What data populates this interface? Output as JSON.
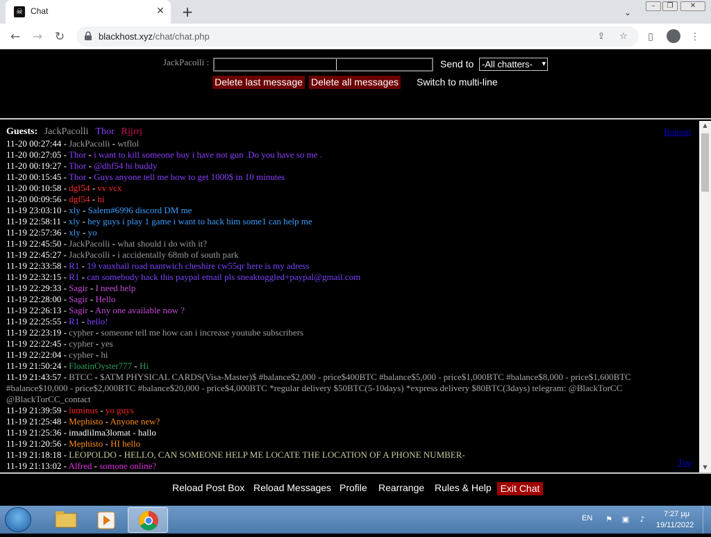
{
  "browser": {
    "tab_title": "Chat",
    "tab_favicon": "☠",
    "url_host": "blackhost.xyz",
    "url_path": "/chat/chat.php"
  },
  "postbox": {
    "nickname": "JackPacolli",
    "nick_suffix": " :",
    "message_value": "",
    "sendto_label": "Send to",
    "sendto_selected": "-All chatters-",
    "delete_last": "Delete last message",
    "delete_all": "Delete all messages",
    "switch_multiline": "Switch to multi-line"
  },
  "messages": {
    "guests_label": "Guests:",
    "guests": [
      {
        "name": "JackPacolli",
        "color": "#9a9a9a"
      },
      {
        "name": "Thor",
        "color": "#8b3fff"
      },
      {
        "name": "Rjjrrj",
        "color": "#cc1155"
      }
    ],
    "bottom_link": "Bottom",
    "top_link": "Top",
    "lines": [
      {
        "ts": "11-20 00:27:44",
        "user": "JackPacolli",
        "text": "wtflol",
        "color": "#9a9a9a"
      },
      {
        "ts": "11-20 00:27:05",
        "user": "Thor",
        "text": "i want to kill someone buy i have not gun .Do you have so me .",
        "color": "#8b3fff"
      },
      {
        "ts": "11-20 00:19:27",
        "user": "Thor",
        "text": "@dhf54 hi buddy",
        "color": "#8b3fff"
      },
      {
        "ts": "11-20 00:15:45",
        "user": "Thor",
        "text": "Guys anyone tell me how to get 1000$ in 10 minutes",
        "color": "#8b3fff"
      },
      {
        "ts": "11-20 00:10:58",
        "user": "dgf54",
        "text": "vv vcx",
        "color": "#ff2a2a"
      },
      {
        "ts": "11-20 00:09:56",
        "user": "dgf54",
        "text": "hi",
        "color": "#ff2a2a"
      },
      {
        "ts": "11-19 23:03:10",
        "user": "xly",
        "text": "Salem#6996 discord DM me",
        "color": "#3aa0ff"
      },
      {
        "ts": "11-19 22:58:11",
        "user": "xly",
        "text": "hey guys i play 1 game i want to hack him some1 can help me",
        "color": "#3aa0ff"
      },
      {
        "ts": "11-19 22:57:36",
        "user": "xly",
        "text": "yo",
        "color": "#3aa0ff"
      },
      {
        "ts": "11-19 22:45:50",
        "user": "JackPacolli",
        "text": "what should i do with it?",
        "color": "#9a9a9a"
      },
      {
        "ts": "11-19 22:45:27",
        "user": "JackPacolli",
        "text": "i accidentally 68mb of south park",
        "color": "#9a9a9a"
      },
      {
        "ts": "11-19 22:33:58",
        "user": "R1",
        "text": "19 vauxhall road nantwich cheshire cw55qr here is my adress",
        "color": "#7b44ff"
      },
      {
        "ts": "11-19 22:32:15",
        "user": "R1",
        "text": "can somebody hack this paypal email pls sneaktoggled+paypal@gmail.com",
        "color": "#7b44ff"
      },
      {
        "ts": "11-19 22:29:33",
        "user": "Sagir",
        "text": "I need help",
        "color": "#c74bd8"
      },
      {
        "ts": "11-19 22:28:00",
        "user": "Sagir",
        "text": "Hello",
        "color": "#c74bd8"
      },
      {
        "ts": "11-19 22:26:13",
        "user": "Sagir",
        "text": "Any one available now ?",
        "color": "#c74bd8"
      },
      {
        "ts": "11-19 22:25:55",
        "user": "R1",
        "text": "hello!",
        "color": "#7b44ff"
      },
      {
        "ts": "11-19 22:23:19",
        "user": "cypher",
        "text": "someone tell me how can i increase youtube subscribers",
        "color": "#9c9c9c"
      },
      {
        "ts": "11-19 22:22:45",
        "user": "cypher",
        "text": "yes",
        "color": "#9c9c9c"
      },
      {
        "ts": "11-19 22:22:04",
        "user": "cypher",
        "text": "hi",
        "color": "#9c9c9c"
      },
      {
        "ts": "11-19 21:50:24",
        "user": "FloatinOyster777",
        "text": "Hi",
        "color": "#2e9e5e"
      },
      {
        "ts": "11-19 21:43:57",
        "user": "BTCC",
        "text": "$ATM PHYSICAL CARDS(Visa-Master)$ #balance$2,000 - price$400BTC #balance$5,000 - price$1,000BTC #balance$8,000 - price$1,600BTC #balance$10,000 - price$2,000BTC #balance$20,000 - price$4,000BTC *regular delivery $50BTC(5-10days) *express delivery $80BTC(3days) telegram: @BlackTorCC @BlackTorCC_contact",
        "color": "#a8a8a8"
      },
      {
        "ts": "11-19 21:39:59",
        "user": "luminus",
        "text": "yo guys",
        "color": "#ff2222"
      },
      {
        "ts": "11-19 21:25:48",
        "user": "Mephisto",
        "text": "Anyone new?",
        "color": "#ff8c1a"
      },
      {
        "ts": "11-19 21:25:36",
        "user": "imadlilma3lomat",
        "text": "hallo",
        "color": "#ffffff"
      },
      {
        "ts": "11-19 21:20:56",
        "user": "Mephisto",
        "text": "HI hello",
        "color": "#ff8c1a"
      },
      {
        "ts": "11-19 21:18:18",
        "user": "LEOPOLDO",
        "text": "HELLO, CAN SOMEONE HELP ME LOCATE THE LOCATION OF A PHONE NUMBER-",
        "color": "#c8c8a0"
      },
      {
        "ts": "11-19 21:13:02",
        "user": "Alfred",
        "text": "somone online?",
        "color": "#e22ee2"
      }
    ]
  },
  "controls": {
    "reload_post": "Reload Post Box",
    "reload_messages": "Reload Messages",
    "profile": "Profile",
    "rearrange": "Rearrange",
    "rules_help": "Rules & Help",
    "exit_chat": "Exit Chat"
  },
  "taskbar": {
    "lang": "EN",
    "time": "7:27 μμ",
    "date": "19/11/2022"
  }
}
